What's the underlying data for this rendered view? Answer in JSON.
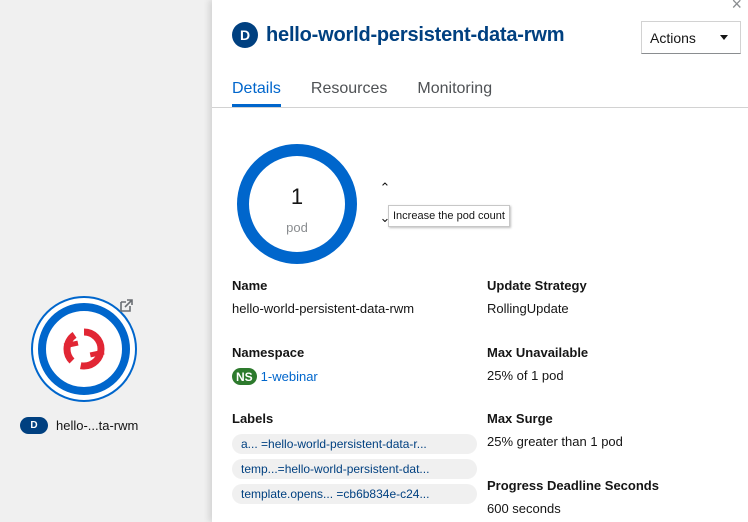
{
  "topology": {
    "node_kind_badge": "D",
    "node_label": "hello-...ta-rwm"
  },
  "panel": {
    "kind_badge": "D",
    "title": "hello-world-persistent-data-rwm",
    "actions_label": "Actions",
    "close_label": "×",
    "tabs": [
      {
        "label": "Details"
      },
      {
        "label": "Resources"
      },
      {
        "label": "Monitoring"
      }
    ]
  },
  "pods": {
    "count": "1",
    "unit": "pod",
    "up_glyph": "⌃",
    "down_glyph": "⌄",
    "tooltip": "Increase the pod count"
  },
  "details": {
    "name": {
      "label": "Name",
      "value": "hello-world-persistent-data-rwm"
    },
    "namespace": {
      "label": "Namespace",
      "badge": "NS",
      "value": "1-webinar"
    },
    "labels": {
      "label": "Labels",
      "items": [
        "a...   =hello-world-persistent-data-r...",
        "temp...=hello-world-persistent-dat...",
        "template.opens...  =cb6b834e-c24..."
      ]
    },
    "update_strategy": {
      "label": "Update Strategy",
      "value": "RollingUpdate"
    },
    "max_unavailable": {
      "label": "Max Unavailable",
      "value": "25% of 1 pod"
    },
    "max_surge": {
      "label": "Max Surge",
      "value": "25% greater than 1 pod"
    },
    "progress_deadline": {
      "label": "Progress Deadline Seconds",
      "value": "600 seconds"
    }
  },
  "colors": {
    "accent": "#0066cc",
    "title": "#004080",
    "ns_badge": "#2d7a2d",
    "openshift_logo": "#e12634"
  }
}
